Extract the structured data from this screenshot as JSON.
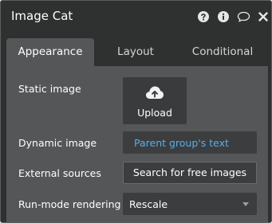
{
  "header": {
    "title": "Image Cat",
    "icons": [
      "help-icon",
      "info-icon",
      "comment-icon",
      "close-icon"
    ]
  },
  "tabs": [
    {
      "label": "Appearance",
      "active": true
    },
    {
      "label": "Layout",
      "active": false
    },
    {
      "label": "Conditional",
      "active": false
    }
  ],
  "appearance": {
    "static_image": {
      "label": "Static image",
      "button_label": "Upload",
      "icon": "upload-cloud-icon"
    },
    "dynamic_image": {
      "label": "Dynamic image",
      "value": "Parent group's text"
    },
    "external_sources": {
      "label": "External sources",
      "button_label": "Search for free images"
    },
    "run_mode_rendering": {
      "label": "Run-mode rendering",
      "value": "Rescale"
    }
  },
  "colors": {
    "panel_bg": "#2f3030",
    "body_bg": "#555657",
    "field_bg": "#3c3d3e",
    "link_blue": "#5aaee8"
  }
}
